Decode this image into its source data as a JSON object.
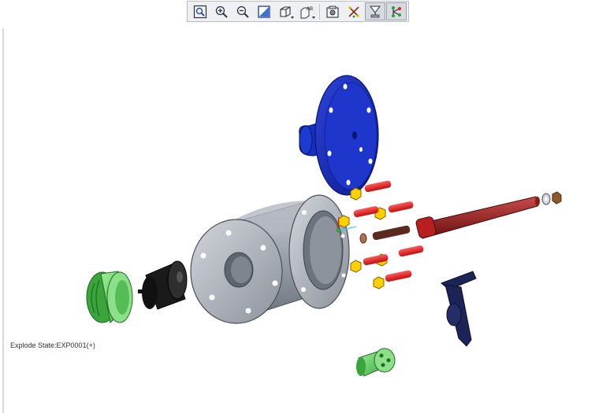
{
  "toolbar": {
    "buttons": [
      {
        "name": "zoom-fit",
        "icon": "zoom-fit-icon"
      },
      {
        "name": "zoom-in",
        "icon": "zoom-in-icon"
      },
      {
        "name": "zoom-out",
        "icon": "zoom-out-icon"
      },
      {
        "name": "repaint",
        "icon": "repaint-icon"
      },
      {
        "name": "display-style",
        "icon": "display-style-icon"
      },
      {
        "name": "named-views",
        "icon": "named-views-icon"
      },
      {
        "name": "view-manager",
        "icon": "view-manager-icon"
      },
      {
        "name": "explode-view",
        "icon": "explode-view-icon"
      },
      {
        "name": "datum-display",
        "icon": "datum-display-icon"
      },
      {
        "name": "spin-center",
        "icon": "spin-center-icon"
      }
    ],
    "named_views_glyph": "AB"
  },
  "viewport": {
    "explode_state_label": "Explode State:EXP0001(+)"
  }
}
